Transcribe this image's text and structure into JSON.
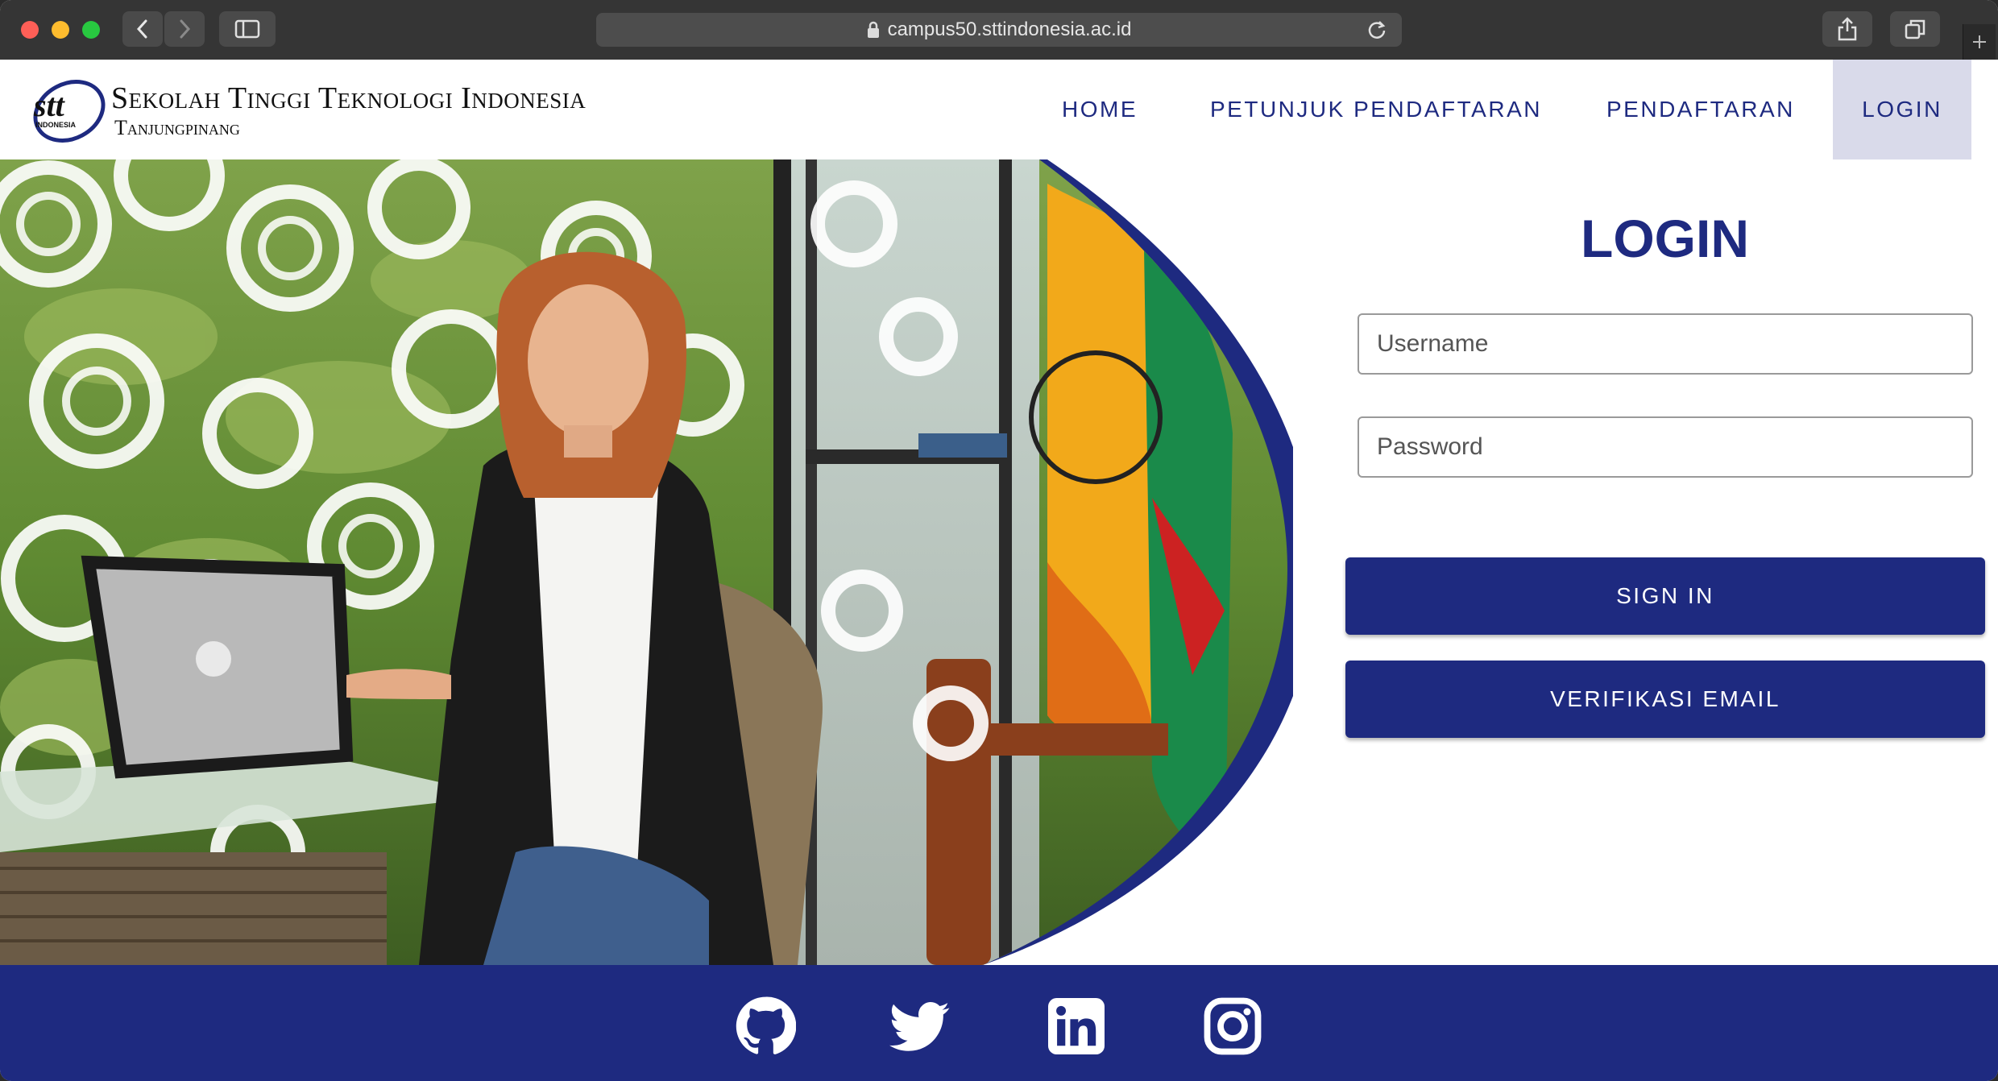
{
  "browser": {
    "url": "campus50.sttindonesia.ac.id"
  },
  "brand": {
    "logo_text": "stt",
    "logo_subtext": "INDONESIA",
    "name": "Sekolah Tinggi Teknologi Indonesia",
    "subtitle": "Tanjungpinang"
  },
  "nav": {
    "items": [
      {
        "label": "HOME"
      },
      {
        "label": "PETUNJUK PENDAFTARAN"
      },
      {
        "label": "PENDAFTARAN"
      },
      {
        "label": "LOGIN"
      }
    ],
    "active": "LOGIN"
  },
  "login": {
    "title": "LOGIN",
    "username_placeholder": "Username",
    "password_placeholder": "Password",
    "signin_label": "SIGN IN",
    "verify_label": "VERIFIKASI EMAIL"
  },
  "footer": {
    "social": [
      "github-icon",
      "twitter-icon",
      "linkedin-icon",
      "instagram-icon"
    ]
  },
  "colors": {
    "brand_blue": "#1e2a80",
    "nav_active_bg": "#d9daea"
  }
}
